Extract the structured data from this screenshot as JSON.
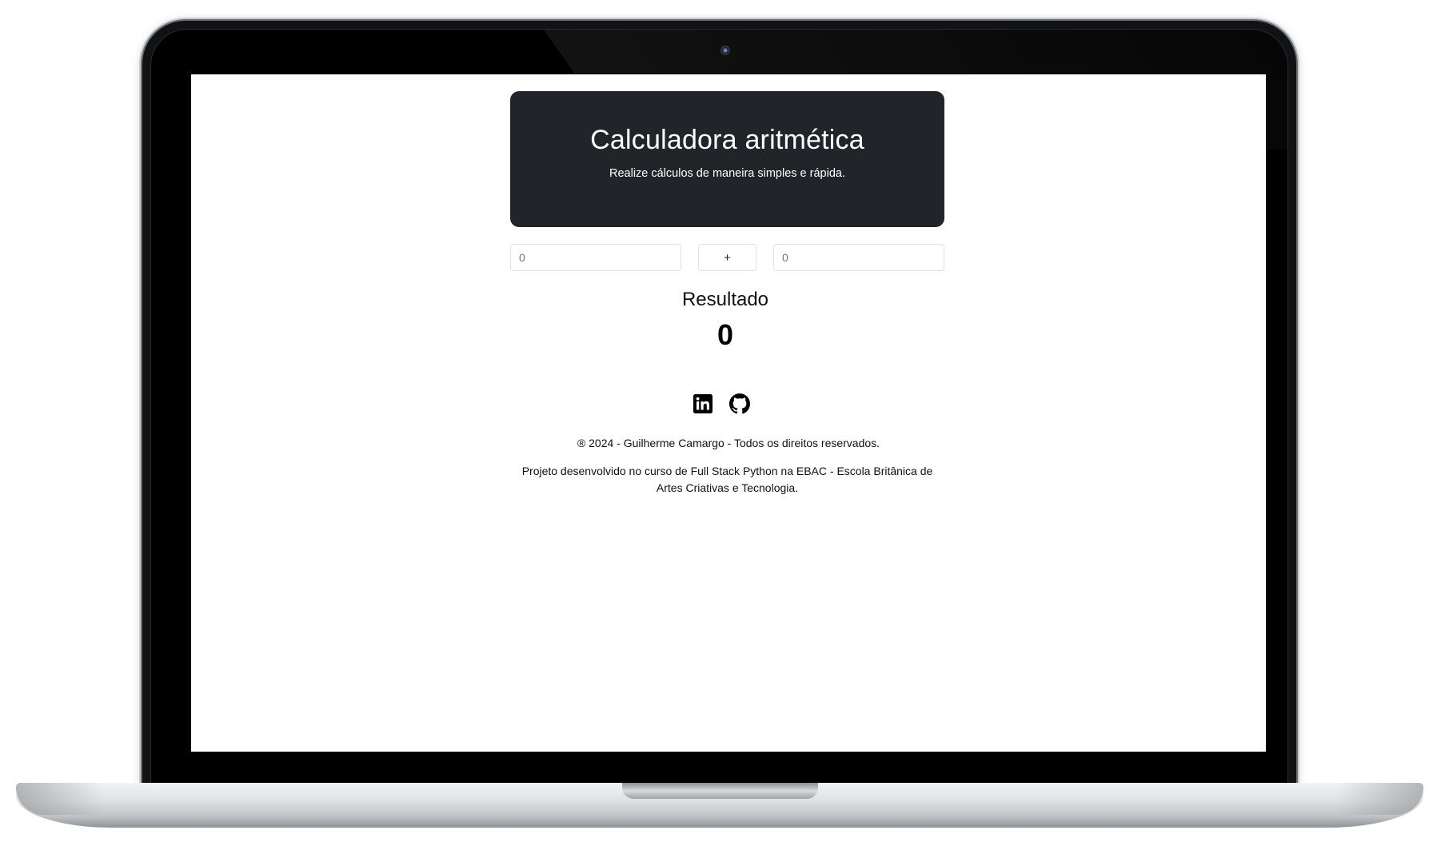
{
  "header": {
    "title": "Calculadora aritmética",
    "subtitle": "Realize cálculos de maneira simples e rápida."
  },
  "calculator": {
    "first_number": {
      "value": "0"
    },
    "operator": {
      "selected": "+"
    },
    "second_number": {
      "value": "0"
    }
  },
  "result": {
    "label": "Resultado",
    "value": "0"
  },
  "footer": {
    "social": [
      {
        "icon": "linkedin-icon"
      },
      {
        "icon": "github-icon"
      }
    ],
    "copyright": "® 2024 - Guilherme Camargo - Todos os direitos reservados.",
    "project": "Projeto desenvolvido no curso de Full Stack Python na EBAC - Escola Britânica de Artes Criativas e Tecnologia."
  },
  "colors": {
    "header_bg": "#212529",
    "header_text": "#ffffff",
    "border": "#dee2e6"
  }
}
